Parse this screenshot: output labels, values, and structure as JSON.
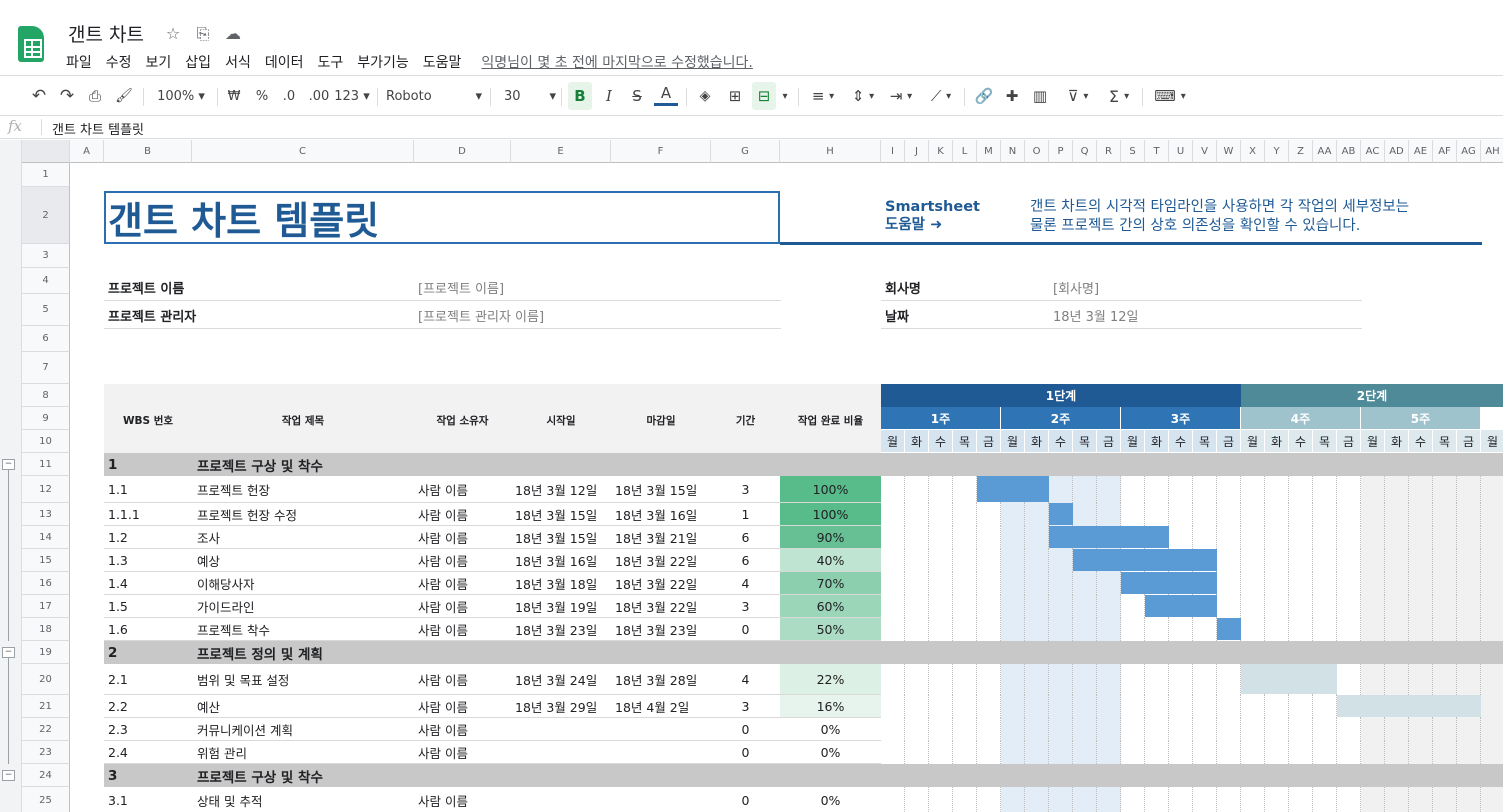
{
  "app": {
    "doc_title": "갠트 차트"
  },
  "menu": [
    "파일",
    "수정",
    "보기",
    "삽입",
    "서식",
    "데이터",
    "도구",
    "부가기능",
    "도움말"
  ],
  "last_edit": "익명님이 몇 초 전에 마지막으로 수정했습니다.",
  "toolbar": {
    "zoom": "100%",
    "currency": "₩",
    "percent": "%",
    "dec_less": ".0",
    "dec_more": ".00",
    "format": "123",
    "font": "Roboto",
    "size": "30"
  },
  "formula_bar": {
    "fx": "fx",
    "value": "갠트 차트 템플릿"
  },
  "columns": [
    "A",
    "B",
    "C",
    "D",
    "E",
    "F",
    "G",
    "H",
    "I",
    "J",
    "K",
    "L",
    "M",
    "N",
    "O",
    "P",
    "Q",
    "R",
    "S",
    "T",
    "U",
    "V",
    "W",
    "X",
    "Y",
    "Z",
    "AA",
    "AB",
    "AC",
    "AD",
    "AE",
    "AF",
    "AG",
    "AH"
  ],
  "rows": [
    "1",
    "2",
    "3",
    "4",
    "5",
    "6",
    "7",
    "8",
    "9",
    "10",
    "11",
    "12",
    "13",
    "14",
    "15",
    "16",
    "17",
    "18",
    "19",
    "20",
    "21",
    "22",
    "23",
    "24",
    "25"
  ],
  "sheet": {
    "title": "갠트 차트 템플릿",
    "help_line1": "Smartsheet",
    "help_line2": "도움말 ➜",
    "help_text1": "갠트 차트의 시각적 타임라인을 사용하면 각 작업의 세부정보는",
    "help_text2": "물론 프로젝트 간의 상호 의존성을 확인할 수 있습니다.",
    "project_name_label": "프로젝트 이름",
    "project_name_value": "[프로젝트 이름]",
    "project_manager_label": "프로젝트 관리자",
    "project_manager_value": "[프로젝트 관리자 이름]",
    "company_label": "회사명",
    "company_value": "[회사명]",
    "date_label": "날짜",
    "date_value": "18년 3월 12일"
  },
  "table_headers": {
    "wbs": "WBS 번호",
    "task": "작업 제목",
    "owner": "작업 소유자",
    "start": "시작일",
    "due": "마감일",
    "duration": "기간",
    "complete": "작업 완료 비율"
  },
  "phases": [
    "1단계",
    "2단계"
  ],
  "weeks": [
    "1주",
    "2주",
    "3주",
    "4주",
    "5주"
  ],
  "days": [
    "월",
    "화",
    "수",
    "목",
    "금",
    "월",
    "화",
    "수",
    "목",
    "금",
    "월",
    "화",
    "수",
    "목",
    "금",
    "월",
    "화",
    "수",
    "목",
    "금",
    "월",
    "화",
    "수",
    "목",
    "금",
    "월"
  ],
  "sections": [
    {
      "num": "1",
      "title": "프로젝트 구상 및 착수"
    },
    {
      "num": "2",
      "title": "프로젝트 정의 및 계획"
    },
    {
      "num": "3",
      "title": "프로젝트 구상 및 착수"
    }
  ],
  "tasks": [
    {
      "wbs": "1.1",
      "title": "프로젝트 헌장",
      "owner": "사람 이름",
      "start": "18년 3월 12일",
      "due": "18년 3월 15일",
      "duration": "3",
      "complete": "100%",
      "bar_start": 4,
      "bar_len": 3,
      "color": "#5b9bd5"
    },
    {
      "wbs": "1.1.1",
      "title": "프로젝트 헌장 수정",
      "owner": "사람 이름",
      "start": "18년 3월 15일",
      "due": "18년 3월 16일",
      "duration": "1",
      "complete": "100%",
      "bar_start": 7,
      "bar_len": 1,
      "color": "#5b9bd5"
    },
    {
      "wbs": "1.2",
      "title": "조사",
      "owner": "사람 이름",
      "start": "18년 3월 15일",
      "due": "18년 3월 21일",
      "duration": "6",
      "complete": "90%",
      "bar_start": 7,
      "bar_len": 5,
      "color": "#5b9bd5"
    },
    {
      "wbs": "1.3",
      "title": "예상",
      "owner": "사람 이름",
      "start": "18년 3월 16일",
      "due": "18년 3월 22일",
      "duration": "6",
      "complete": "40%",
      "bar_start": 8,
      "bar_len": 6,
      "color": "#5b9bd5"
    },
    {
      "wbs": "1.4",
      "title": "이해당사자",
      "owner": "사람 이름",
      "start": "18년 3월 18일",
      "due": "18년 3월 22일",
      "duration": "4",
      "complete": "70%",
      "bar_start": 10,
      "bar_len": 4,
      "color": "#5b9bd5"
    },
    {
      "wbs": "1.5",
      "title": "가이드라인",
      "owner": "사람 이름",
      "start": "18년 3월 19일",
      "due": "18년 3월 22일",
      "duration": "3",
      "complete": "60%",
      "bar_start": 11,
      "bar_len": 3,
      "color": "#5b9bd5"
    },
    {
      "wbs": "1.6",
      "title": "프로젝트 착수",
      "owner": "사람 이름",
      "start": "18년 3월 23일",
      "due": "18년 3월 23일",
      "duration": "0",
      "complete": "50%",
      "bar_start": 14,
      "bar_len": 1,
      "color": "#5b9bd5"
    },
    {
      "wbs": "2.1",
      "title": "범위 및 목표 설정",
      "owner": "사람 이름",
      "start": "18년 3월 24일",
      "due": "18년 3월 28일",
      "duration": "4",
      "complete": "22%",
      "bar_start": 15,
      "bar_len": 4,
      "color": "#d2e1e6"
    },
    {
      "wbs": "2.2",
      "title": "예산",
      "owner": "사람 이름",
      "start": "18년 3월 29일",
      "due": "18년 4월 2일",
      "duration": "3",
      "complete": "16%",
      "bar_start": 19,
      "bar_len": 6,
      "color": "#d2e1e6"
    },
    {
      "wbs": "2.3",
      "title": "커뮤니케이션 계획",
      "owner": "사람 이름",
      "start": "",
      "due": "",
      "duration": "0",
      "complete": "0%",
      "bar_start": 0,
      "bar_len": 0,
      "color": ""
    },
    {
      "wbs": "2.4",
      "title": "위험 관리",
      "owner": "사람 이름",
      "start": "",
      "due": "",
      "duration": "0",
      "complete": "0%",
      "bar_start": 0,
      "bar_len": 0,
      "color": ""
    },
    {
      "wbs": "3.1",
      "title": "상태 및 추적",
      "owner": "사람 이름",
      "start": "",
      "due": "",
      "duration": "0",
      "complete": "0%",
      "bar_start": 0,
      "bar_len": 0,
      "color": ""
    }
  ],
  "colors": {
    "title_blue": "#1f5a95",
    "phase1": "#1f5a95",
    "phase2": "#4e8a98",
    "week1": "#2f75b5",
    "week2": "#9fc3cc",
    "complete_fill": "#57bb8a",
    "bar_blue": "#5b9bd5"
  }
}
